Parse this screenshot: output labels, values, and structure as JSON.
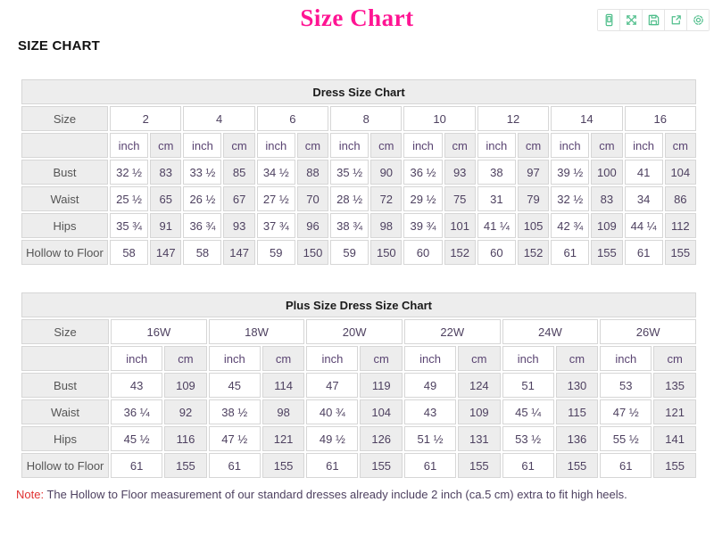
{
  "page": {
    "title": "Size Chart",
    "heading": "SIZE CHART",
    "note_label": "Note:",
    "note_text": " The Hollow to Floor measurement of our standard dresses already include 2 inch (ca.5 cm) extra to fit high heels."
  },
  "toolbar": {
    "icons": [
      "mobile-icon",
      "fullscreen-icon",
      "save-icon",
      "share-icon",
      "settings-icon"
    ]
  },
  "colors": {
    "accent": "#ff1493",
    "icon_green": "#4fbe8b",
    "note_red": "#e03131",
    "cell_gray": "#ededed",
    "border_gray": "#d6d6d6",
    "data_text": "#4e4160",
    "label_text": "#555555",
    "unit_text": "#5a4472"
  },
  "tables": [
    {
      "title": "Dress Size Chart",
      "size_label": "Size",
      "sizes": [
        "2",
        "4",
        "6",
        "8",
        "10",
        "12",
        "14",
        "16"
      ],
      "unit_labels": [
        "inch",
        "cm"
      ],
      "rows": [
        {
          "label": "Bust",
          "values": [
            "32 ½",
            "83",
            "33 ½",
            "85",
            "34 ½",
            "88",
            "35 ½",
            "90",
            "36 ½",
            "93",
            "38",
            "97",
            "39 ½",
            "100",
            "41",
            "104"
          ]
        },
        {
          "label": "Waist",
          "values": [
            "25 ½",
            "65",
            "26 ½",
            "67",
            "27 ½",
            "70",
            "28 ½",
            "72",
            "29 ½",
            "75",
            "31",
            "79",
            "32 ½",
            "83",
            "34",
            "86"
          ]
        },
        {
          "label": "Hips",
          "values": [
            "35 ¾",
            "91",
            "36 ¾",
            "93",
            "37 ¾",
            "96",
            "38 ¾",
            "98",
            "39 ¾",
            "101",
            "41 ¼",
            "105",
            "42 ¾",
            "109",
            "44 ¼",
            "112"
          ]
        },
        {
          "label": "Hollow to Floor",
          "values": [
            "58",
            "147",
            "58",
            "147",
            "59",
            "150",
            "59",
            "150",
            "60",
            "152",
            "60",
            "152",
            "61",
            "155",
            "61",
            "155"
          ]
        }
      ]
    },
    {
      "title": "Plus Size Dress Size Chart",
      "size_label": "Size",
      "sizes": [
        "16W",
        "18W",
        "20W",
        "22W",
        "24W",
        "26W"
      ],
      "unit_labels": [
        "inch",
        "cm"
      ],
      "rows": [
        {
          "label": "Bust",
          "values": [
            "43",
            "109",
            "45",
            "114",
            "47",
            "119",
            "49",
            "124",
            "51",
            "130",
            "53",
            "135"
          ]
        },
        {
          "label": "Waist",
          "values": [
            "36 ¼",
            "92",
            "38 ½",
            "98",
            "40 ¾",
            "104",
            "43",
            "109",
            "45 ¼",
            "115",
            "47 ½",
            "121"
          ]
        },
        {
          "label": "Hips",
          "values": [
            "45 ½",
            "116",
            "47 ½",
            "121",
            "49 ½",
            "126",
            "51 ½",
            "131",
            "53 ½",
            "136",
            "55 ½",
            "141"
          ]
        },
        {
          "label": "Hollow to Floor",
          "values": [
            "61",
            "155",
            "61",
            "155",
            "61",
            "155",
            "61",
            "155",
            "61",
            "155",
            "61",
            "155"
          ]
        }
      ]
    }
  ]
}
